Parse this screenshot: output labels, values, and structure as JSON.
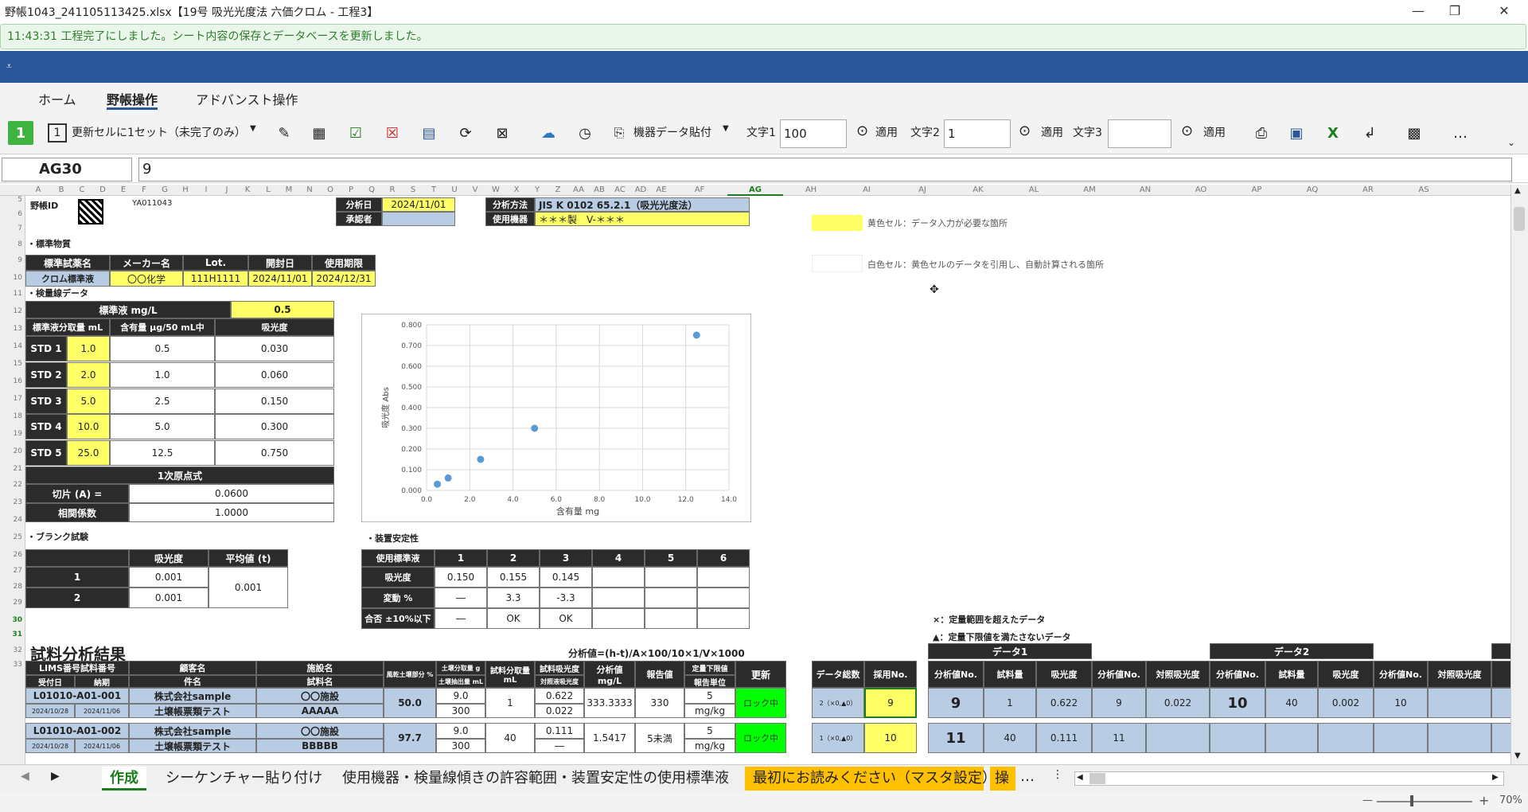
{
  "window": {
    "title": "野帳1043_241105113425.xlsx【19号 吸光光度法 六価クロム - 工程3】"
  },
  "status": {
    "message": "11:43:31 工程完了にしました。シート内容の保存とデータベースを更新しました。"
  },
  "ribbon_tabs": [
    "ホーム",
    "野帳操作",
    "アドバンスト操作"
  ],
  "toolbar": {
    "mode_label": "更新セルに1セット（未完了のみ）",
    "instrument_paste": "機器データ貼付",
    "text1_label": "文字1",
    "text1_value": "100",
    "apply": "適用",
    "text2_label": "文字2",
    "text2_value": "1",
    "text3_label": "文字3",
    "text3_value": "",
    "badge1": "1"
  },
  "formula_bar": {
    "name_box": "AG30",
    "formula": "9"
  },
  "columns": [
    "A",
    "B",
    "C",
    "D",
    "E",
    "F",
    "G",
    "H",
    "I",
    "J",
    "K",
    "L",
    "M",
    "N",
    "O",
    "P",
    "Q",
    "R",
    "S",
    "T",
    "U",
    "V",
    "W",
    "X",
    "Y",
    "Z",
    "AA",
    "AB",
    "AC",
    "AD",
    "AE",
    "AF",
    "AG",
    "AH",
    "AI",
    "AJ",
    "AK",
    "AL",
    "AM",
    "AN",
    "AO",
    "AP",
    "AQ",
    "AR",
    "AS"
  ],
  "rows": [
    "5",
    "6",
    "7",
    "8",
    "9",
    "10",
    "11",
    "12",
    "13",
    "14",
    "15",
    "16",
    "17",
    "18",
    "19",
    "20",
    "21",
    "22",
    "23",
    "24",
    "25",
    "26",
    "27",
    "28",
    "29",
    "30",
    "31",
    "32",
    "33"
  ],
  "header_info": {
    "notebook_id_label": "野帳ID",
    "notebook_id": "YA011043",
    "date_label": "分析日",
    "date": "2024/11/01",
    "approver_label": "承認者",
    "method_label": "分析方法",
    "method": "JIS K 0102 65.2.1（吸光光度法）",
    "equipment_label": "使用機器",
    "equipment": "＊＊＊製　V-＊＊＊"
  },
  "legend": {
    "yellow": "黄色セル：データ入力が必要な箇所",
    "white": "白色セル：黄色セルのデータを引用し、自動計算される箇所"
  },
  "standard": {
    "section": "・標準物質",
    "headers": [
      "標準試薬名",
      "メーカー名",
      "Lot.",
      "開封日",
      "使用期限"
    ],
    "row": [
      "クロム標準液",
      "〇〇化学",
      "111H1111",
      "2024/11/01",
      "2024/12/31"
    ]
  },
  "calibration": {
    "section": "・検量線データ",
    "std_conc_label": "標準液 mg/L",
    "std_conc": "0.5",
    "headers": [
      "標準液分取量 mL",
      "含有量 μg/50 mL中",
      "吸光度"
    ],
    "rows": [
      [
        "STD 1",
        "1.0",
        "0.5",
        "0.030"
      ],
      [
        "STD 2",
        "2.0",
        "1.0",
        "0.060"
      ],
      [
        "STD 3",
        "5.0",
        "2.5",
        "0.150"
      ],
      [
        "STD 4",
        "10.0",
        "5.0",
        "0.300"
      ],
      [
        "STD 5",
        "25.0",
        "12.5",
        "0.750"
      ]
    ],
    "fit_label": "1次原点式",
    "intercept_label": "切片 (A) =",
    "intercept": "0.0600",
    "corr_label": "相関係数",
    "corr": "1.0000"
  },
  "chart_data": {
    "type": "scatter",
    "xlabel": "含有量 mg",
    "ylabel": "吸光度 Abs",
    "xlim": [
      0,
      14
    ],
    "ylim": [
      0,
      0.8
    ],
    "xticks": [
      "0.0",
      "2.0",
      "4.0",
      "6.0",
      "8.0",
      "10.0",
      "12.0",
      "14.0"
    ],
    "yticks": [
      "0.000",
      "0.100",
      "0.200",
      "0.300",
      "0.400",
      "0.500",
      "0.600",
      "0.700",
      "0.800"
    ],
    "grid": true,
    "x": [
      0.5,
      1.0,
      2.5,
      5.0,
      12.5
    ],
    "y": [
      0.03,
      0.06,
      0.15,
      0.3,
      0.75
    ],
    "color": "#5b9bd5"
  },
  "blank": {
    "section": "・ブランク試験",
    "headers": [
      "吸光度",
      "平均値 (t)"
    ],
    "rows": [
      [
        "1",
        "0.001"
      ],
      [
        "2",
        "0.001"
      ]
    ],
    "average": "0.001"
  },
  "stability": {
    "section": "・装置安定性",
    "header_label": "使用標準液",
    "cols": [
      "1",
      "2",
      "3",
      "4",
      "5",
      "6"
    ],
    "rows": [
      {
        "label": "吸光度",
        "vals": [
          "0.150",
          "0.155",
          "0.145",
          "",
          "",
          ""
        ]
      },
      {
        "label": "変動 %",
        "vals": [
          "―",
          "3.3",
          "-3.3",
          "",
          "",
          ""
        ]
      },
      {
        "label": "合否 ±10%以下",
        "vals": [
          "―",
          "OK",
          "OK",
          "",
          "",
          ""
        ]
      }
    ]
  },
  "results": {
    "title": "試料分析結果",
    "formula": "分析値=(h-t)/A×100/10×1/V×1000",
    "note1": "×：定量範囲を超えたデータ",
    "note2": "▲：定量下限値を満たさないデータ",
    "headers": {
      "lims": "LIMS番号試料番号",
      "received": "受付日",
      "due": "納期",
      "client": "顧客名",
      "case": "件名",
      "facility": "施設名",
      "sample": "試料名",
      "dry": "風乾土壌部分 %",
      "soil1": "土壌分取量 g",
      "soil2": "土壌抽出量 mL",
      "take": "試料分取量 mL",
      "abs1": "試料吸光度",
      "abs2": "対照液吸光度",
      "value": "分析値 mg/L",
      "report": "報告値",
      "lim1": "定量下限値",
      "lim2": "報告単位",
      "update": "更新",
      "count": "データ総数",
      "adopt": "採用No.",
      "data1": "データ1",
      "data2": "データ2",
      "dno": "分析値No.",
      "dqty": "試料量",
      "dabs": "吸光度",
      "dno2": "分析値No.",
      "dctrl": "対照吸光度"
    },
    "rows": [
      {
        "lims": "L01010-A01-001",
        "received": "2024/10/28",
        "due": "2024/11/06",
        "client": "株式会社sample",
        "case": "土壌帳票類テスト",
        "facility": "〇〇施設",
        "sample": "AAAAA",
        "dry": "50.0",
        "soil1": "9.0",
        "soil2": "300",
        "take": "1",
        "abs1": "0.622",
        "abs2": "0.022",
        "value": "333.3333",
        "report": "330",
        "lim1": "5",
        "lim2": "mg/kg",
        "update": "ロック中",
        "count": "2（×0,▲0）",
        "adopt": "9",
        "d1no": "9",
        "d1qty": "1",
        "d1abs": "0.622",
        "d1no2": "9",
        "d1ctrl": "0.022",
        "d2no": "10",
        "d2qty": "40",
        "d2abs": "0.002",
        "d2no2": "10"
      },
      {
        "lims": "L01010-A01-002",
        "received": "2024/10/28",
        "due": "2024/11/06",
        "client": "株式会社sample",
        "case": "土壌帳票類テスト",
        "facility": "〇〇施設",
        "sample": "BBBBB",
        "dry": "97.7",
        "soil1": "9.0",
        "soil2": "300",
        "take": "40",
        "abs1": "0.111",
        "abs2": "―",
        "value": "1.5417",
        "report": "5未満",
        "lim1": "5",
        "lim2": "mg/kg",
        "update": "ロック中",
        "count": "1（×0,▲0）",
        "adopt": "10",
        "d1no": "11",
        "d1qty": "40",
        "d1abs": "0.111",
        "d1no2": "11"
      }
    ]
  },
  "sheet_tabs": [
    "作成",
    "シーケンチャー貼り付け",
    "使用機器・検量線傾きの許容範囲・装置安定性の使用標準液",
    "最初にお読みください（マスタ設定）",
    "操"
  ],
  "zoom": "70%"
}
